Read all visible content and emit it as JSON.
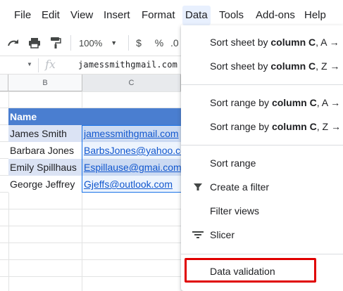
{
  "menubar": {
    "items": [
      "File",
      "Edit",
      "View",
      "Insert",
      "Format",
      "Data",
      "Tools",
      "Add-ons",
      "Help"
    ],
    "active": "Data"
  },
  "toolbar": {
    "zoom": "100%",
    "currency": "$",
    "percent": "%",
    "decimal": ".0"
  },
  "formula_bar": {
    "fx": "fx",
    "content": "jamessmithgmail.com"
  },
  "columns": {
    "b": "B",
    "c": "C"
  },
  "sheet": {
    "header": {
      "name": "Name",
      "email": ""
    },
    "rows": [
      {
        "name": "James Smith",
        "email": "jamessmithgmail.com"
      },
      {
        "name": "Barbara Jones",
        "email": "BarbsJones@yahoo.com"
      },
      {
        "name": "Emily Spillhaus",
        "email": "Espillause@gmai.com"
      },
      {
        "name": "George Jeffrey",
        "email": "Gjeffs@outlook.com"
      }
    ]
  },
  "data_menu": {
    "sort_sheet_az_prefix": "Sort sheet by ",
    "sort_sheet_az_col": "column C",
    "sort_sheet_az_suffix": ", A →",
    "sort_sheet_za_prefix": "Sort sheet by ",
    "sort_sheet_za_col": "column C",
    "sort_sheet_za_suffix": ", Z →",
    "sort_range_az_prefix": "Sort range by ",
    "sort_range_az_col": "column C",
    "sort_range_az_suffix": ", A →",
    "sort_range_za_prefix": "Sort range by ",
    "sort_range_za_col": "column C",
    "sort_range_za_suffix": ", Z →",
    "sort_range": "Sort range",
    "create_filter": "Create a filter",
    "filter_views": "Filter views",
    "slicer": "Slicer",
    "data_validation": "Data validation"
  },
  "colors": {
    "header_fill": "#4a7ed0",
    "band_fill": "#dbe3f4",
    "link": "#1155cc",
    "highlight": "#e00000"
  }
}
